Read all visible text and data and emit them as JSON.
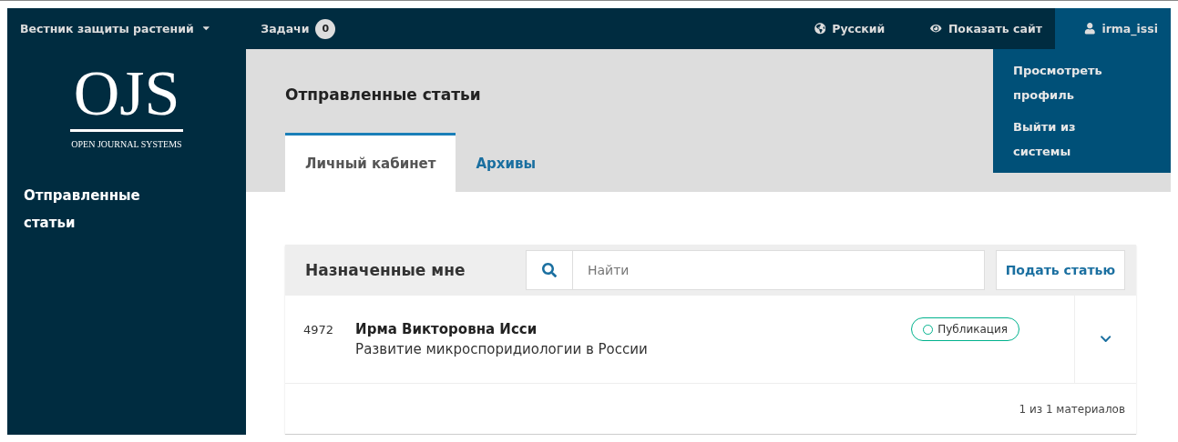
{
  "topbar": {
    "journal": "Вестник защиты растений",
    "tasks_label": "Задачи",
    "tasks_count": "0",
    "language": "Русский",
    "view_site": "Показать сайт",
    "user": "irma_issi"
  },
  "user_menu": {
    "expanded": true,
    "items": [
      "Просмотреть профиль",
      "Выйти из системы"
    ]
  },
  "logo": {
    "mark": "OJS",
    "caption": "OPEN JOURNAL SYSTEMS"
  },
  "sidebar": {
    "items": [
      {
        "label": "Отправленные статьи",
        "selected": true
      }
    ]
  },
  "page_title": "Отправленные статьи",
  "tabs": [
    {
      "label": "Личный кабинет",
      "selected": true
    },
    {
      "label": "Архивы",
      "selected": false
    }
  ],
  "panel": {
    "title": "Назначенные мне",
    "search": {
      "placeholder": "Найти"
    },
    "button": "Подать статью",
    "rows": [
      {
        "id": "4972",
        "author": "Ирма Викторовна Исси",
        "title": "Развитие микроспоридиологии в России",
        "stage": "Публикация",
        "expanded": false
      }
    ],
    "footer": "1 из 1 материалов"
  }
}
